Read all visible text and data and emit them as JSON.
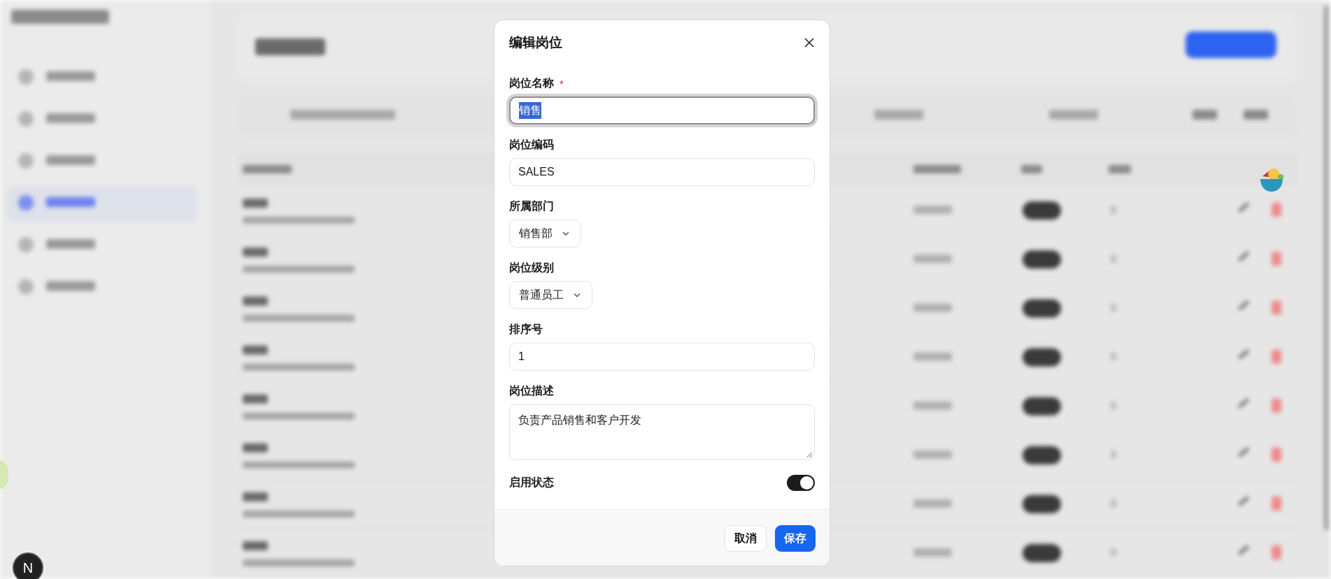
{
  "dialog": {
    "title": "编辑岗位",
    "required_mark": "*",
    "fields": [
      {
        "kind": "text",
        "label": "岗位名称",
        "required": true,
        "value": "销售",
        "focused": true,
        "text_selected": true
      },
      {
        "kind": "text",
        "label": "岗位编码",
        "required": false,
        "value": "SALES",
        "focused": false,
        "text_selected": false
      },
      {
        "kind": "select",
        "label": "所属部门",
        "required": false,
        "value": "销售部"
      },
      {
        "kind": "select",
        "label": "岗位级别",
        "required": false,
        "value": "普通员工"
      },
      {
        "kind": "text",
        "label": "排序号",
        "required": false,
        "value": "1",
        "focused": false,
        "text_selected": false
      },
      {
        "kind": "textarea",
        "label": "岗位描述",
        "required": false,
        "value": "负责产品销售和客户开发"
      }
    ],
    "switch": {
      "label": "启用状态",
      "on": true
    },
    "buttons": [
      {
        "label": "取消",
        "kind": "secondary"
      },
      {
        "label": "保存",
        "kind": "primary"
      }
    ]
  },
  "dev_badge": "N"
}
